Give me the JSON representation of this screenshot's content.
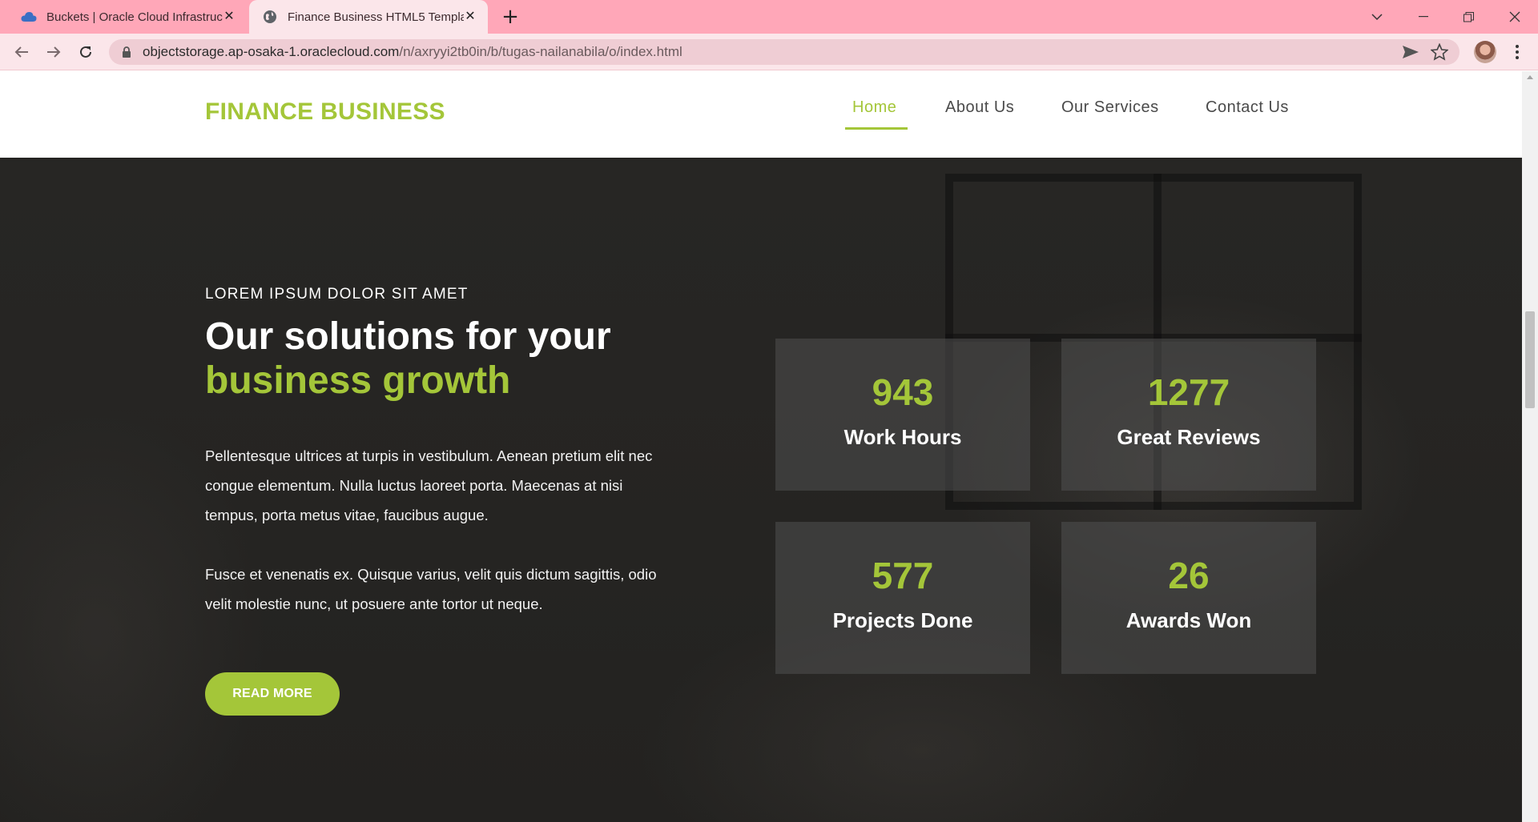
{
  "browser": {
    "tabs": [
      {
        "title": "Buckets | Oracle Cloud Infrastructure",
        "active": false,
        "favicon": "cloud-icon"
      },
      {
        "title": "Finance Business HTML5 Template",
        "active": true,
        "favicon": "globe-icon"
      }
    ],
    "url_host": "objectstorage.ap-osaka-1.oraclecloud.com",
    "url_path": "/n/axryyi2tb0in/b/tugas-nailanabila/o/index.html",
    "icons": [
      "back-icon",
      "forward-icon",
      "reload-icon",
      "lock-icon",
      "send-icon",
      "star-icon",
      "menu-icon"
    ]
  },
  "site": {
    "logo": "FINANCE BUSINESS",
    "nav": [
      {
        "label": "Home",
        "active": true
      },
      {
        "label": "About Us",
        "active": false
      },
      {
        "label": "Our Services",
        "active": false
      },
      {
        "label": "Contact Us",
        "active": false
      }
    ]
  },
  "hero": {
    "kicker": "LOREM IPSUM DOLOR SIT AMET",
    "headline_line1": "Our solutions for your",
    "headline_line2": "business growth",
    "paragraph1_lines": [
      "Pellentesque ultrices at turpis in vestibulum. Aenean pretium elit nec",
      "congue elementum. Nulla luctus laoreet porta. Maecenas at nisi",
      "tempus, porta metus vitae, faucibus augue."
    ],
    "paragraph2_lines": [
      "Fusce et venenatis ex. Quisque varius, velit quis dictum sagittis, odio",
      "velit molestie nunc, ut posuere ante tortor ut neque."
    ],
    "button_label": "READ MORE"
  },
  "stats": [
    {
      "value": "943",
      "label": "Work Hours"
    },
    {
      "value": "1277",
      "label": "Great Reviews"
    },
    {
      "value": "577",
      "label": "Projects Done"
    },
    {
      "value": "26",
      "label": "Awards Won"
    }
  ],
  "colors": {
    "accent": "#a4c639",
    "tab_strip": "#ffa7b8",
    "hero_background": "#252422"
  }
}
